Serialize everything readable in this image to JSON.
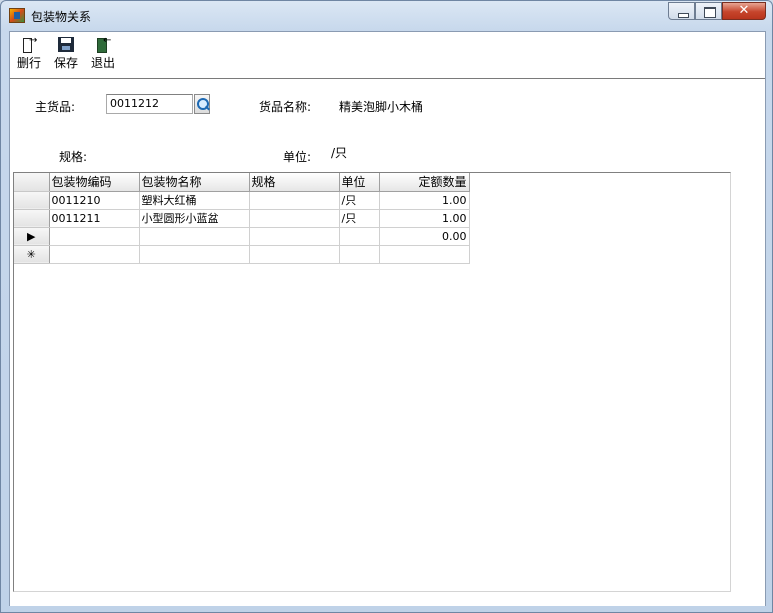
{
  "window": {
    "title": "包装物关系"
  },
  "toolbar": {
    "delete_row": "删行",
    "save": "保存",
    "exit": "退出"
  },
  "form": {
    "main_item_label": "主货品:",
    "main_item_value": "0011212",
    "item_name_label": "货品名称:",
    "item_name_value": "精美泡脚小木桶",
    "spec_label": "规格:",
    "spec_value": "",
    "unit_label": "单位:",
    "unit_value": "/只"
  },
  "grid": {
    "columns": [
      "包装物编码",
      "包装物名称",
      "规格",
      "单位",
      "定额数量"
    ],
    "rows": [
      {
        "marker": "",
        "code": "0011210",
        "name": "塑料大红桶",
        "spec": "",
        "unit": "/只",
        "qty": "1.00"
      },
      {
        "marker": "",
        "code": "0011211",
        "name": "小型圆形小蓝盆",
        "spec": "",
        "unit": "/只",
        "qty": "1.00"
      },
      {
        "marker": "▶",
        "code": "",
        "name": "",
        "spec": "",
        "unit": "",
        "qty": "0.00"
      },
      {
        "marker": "✳",
        "code": "",
        "name": "",
        "spec": "",
        "unit": "",
        "qty": ""
      }
    ]
  }
}
